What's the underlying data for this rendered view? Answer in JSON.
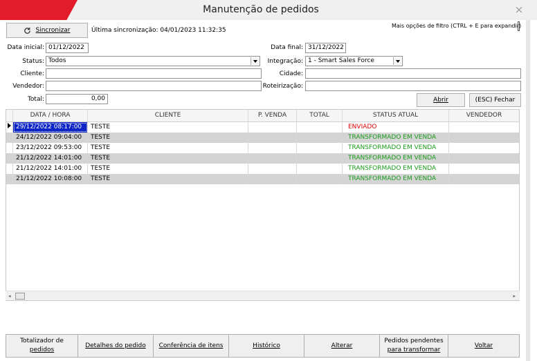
{
  "window": {
    "title": "Manutenção de pedidos",
    "close_glyph": "×"
  },
  "toolbar": {
    "sync_button": "Sincronizar",
    "last_sync": "Última sincronização: 04/01/2023 11:32:35",
    "filter_hint": "Mais opções de filtro (CTRL + E para expandir)"
  },
  "filters": {
    "data_inicial_label": "Data inicial:",
    "data_inicial_value": "01/12/2022",
    "data_final_label": "Data final:",
    "data_final_value": "31/12/2022",
    "status_label": "Status:",
    "status_value": "Todos",
    "integracao_label": "Integração:",
    "integracao_value": "1 - Smart Sales Force",
    "cliente_label": "Cliente:",
    "cliente_value": "",
    "cidade_label": "Cidade:",
    "cidade_value": "",
    "vendedor_label": "Vendedor:",
    "vendedor_value": "",
    "roteirizacao_label": "Roteirização:",
    "roteirizacao_value": "",
    "total_label": "Total:",
    "total_value": "0,00"
  },
  "actions": {
    "abrir": "Abrir",
    "fechar": "(ESC) Fechar"
  },
  "table": {
    "columns": [
      "DATA / HORA",
      "CLIENTE",
      "P. VENDA",
      "TOTAL",
      "STATUS ATUAL",
      "VENDEDOR"
    ],
    "rows": [
      {
        "data": "29/12/2022 08:17:00",
        "cliente": "TESTE",
        "pvenda": "",
        "total": "",
        "status": "ENVIADO",
        "vendedor": ""
      },
      {
        "data": "24/12/2022 09:04:00",
        "cliente": "TESTE",
        "pvenda": "",
        "total": "",
        "status": "TRANSFORMADO EM VENDA",
        "vendedor": ""
      },
      {
        "data": "23/12/2022 09:53:00",
        "cliente": "TESTE",
        "pvenda": "",
        "total": "",
        "status": "TRANSFORMADO EM VENDA",
        "vendedor": ""
      },
      {
        "data": "21/12/2022 14:01:00",
        "cliente": "TESTE",
        "pvenda": "",
        "total": "",
        "status": "TRANSFORMADO EM VENDA",
        "vendedor": ""
      },
      {
        "data": "21/12/2022 14:01:00",
        "cliente": "TESTE",
        "pvenda": "",
        "total": "",
        "status": "TRANSFORMADO EM VENDA",
        "vendedor": ""
      },
      {
        "data": "21/12/2022 10:08:00",
        "cliente": "TESTE",
        "pvenda": "",
        "total": "",
        "status": "TRANSFORMADO EM VENDA",
        "vendedor": ""
      }
    ]
  },
  "colors": {
    "title_accent": "#e21c2a",
    "status_enviado": "#e00000",
    "status_transformado": "#1a9a1a",
    "selection": "#0a24c8"
  },
  "bottom": {
    "totalizador_1": "Totalizador de",
    "totalizador_2": "pedidos",
    "detalhes": "Detalhes do pedido",
    "conferencia": "Conferência de itens",
    "historico": "Histórico",
    "alterar": "Alterar",
    "pendentes_1": "Pedidos pendentes",
    "pendentes_2": "para transformar",
    "voltar": "Voltar"
  }
}
